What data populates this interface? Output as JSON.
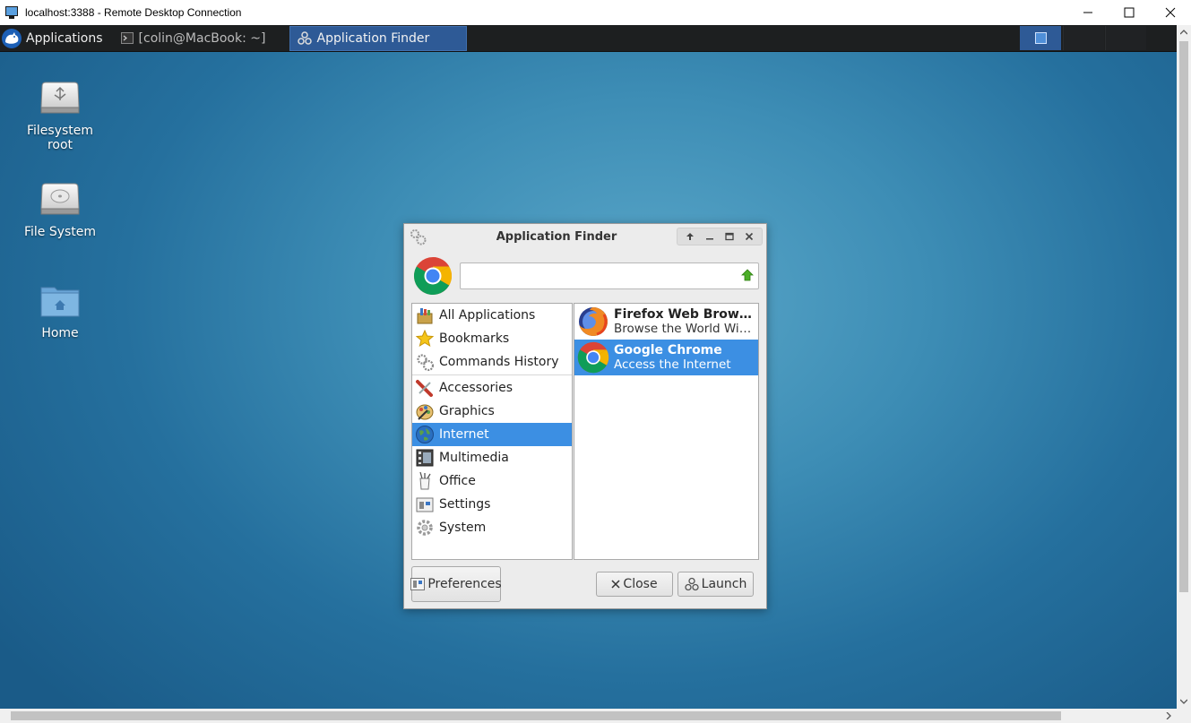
{
  "rdp": {
    "title": "localhost:3388 - Remote Desktop Connection",
    "icon": "rdp-monitor-icon",
    "controls": [
      "minimize-icon",
      "maximize-icon",
      "close-icon"
    ]
  },
  "panel": {
    "applications_label": "Applications",
    "tasks": [
      {
        "label": "[colin@MacBook: ~]",
        "icon": "terminal-icon"
      },
      {
        "label": "Application Finder",
        "icon": "appfinder-icon"
      }
    ]
  },
  "desktop": {
    "icons": [
      {
        "line1": "Filesystem",
        "line2": "root",
        "icon": "usb-drive-icon"
      },
      {
        "line1": "File System",
        "line2": "",
        "icon": "hard-drive-icon"
      },
      {
        "line1": "Home",
        "line2": "",
        "icon": "home-folder-icon"
      }
    ]
  },
  "finder": {
    "title": "Application Finder",
    "search": {
      "value": "",
      "placeholder": ""
    },
    "categories": [
      {
        "label": "All Applications",
        "icon": "all-apps-icon"
      },
      {
        "label": "Bookmarks",
        "icon": "star-icon"
      },
      {
        "label": "Commands History",
        "icon": "gears-icon"
      },
      {
        "label": "Accessories",
        "icon": "accessories-icon"
      },
      {
        "label": "Graphics",
        "icon": "graphics-icon"
      },
      {
        "label": "Internet",
        "icon": "globe-icon",
        "selected": true
      },
      {
        "label": "Multimedia",
        "icon": "multimedia-icon"
      },
      {
        "label": "Office",
        "icon": "office-icon"
      },
      {
        "label": "Settings",
        "icon": "settings-icon"
      },
      {
        "label": "System",
        "icon": "system-gear-icon"
      }
    ],
    "results": [
      {
        "name": "Firefox Web Browser",
        "desc": "Browse the World Wide Web",
        "icon": "firefox-icon"
      },
      {
        "name": "Google Chrome",
        "desc": "Access the Internet",
        "icon": "chrome-icon",
        "selected": true
      }
    ],
    "buttons": {
      "preferences": "Preferences",
      "close": "Close",
      "launch": "Launch"
    }
  },
  "colors": {
    "selection": "#3c8fe3",
    "panel": "#1d1f20",
    "active_task": "#2e5a96"
  }
}
